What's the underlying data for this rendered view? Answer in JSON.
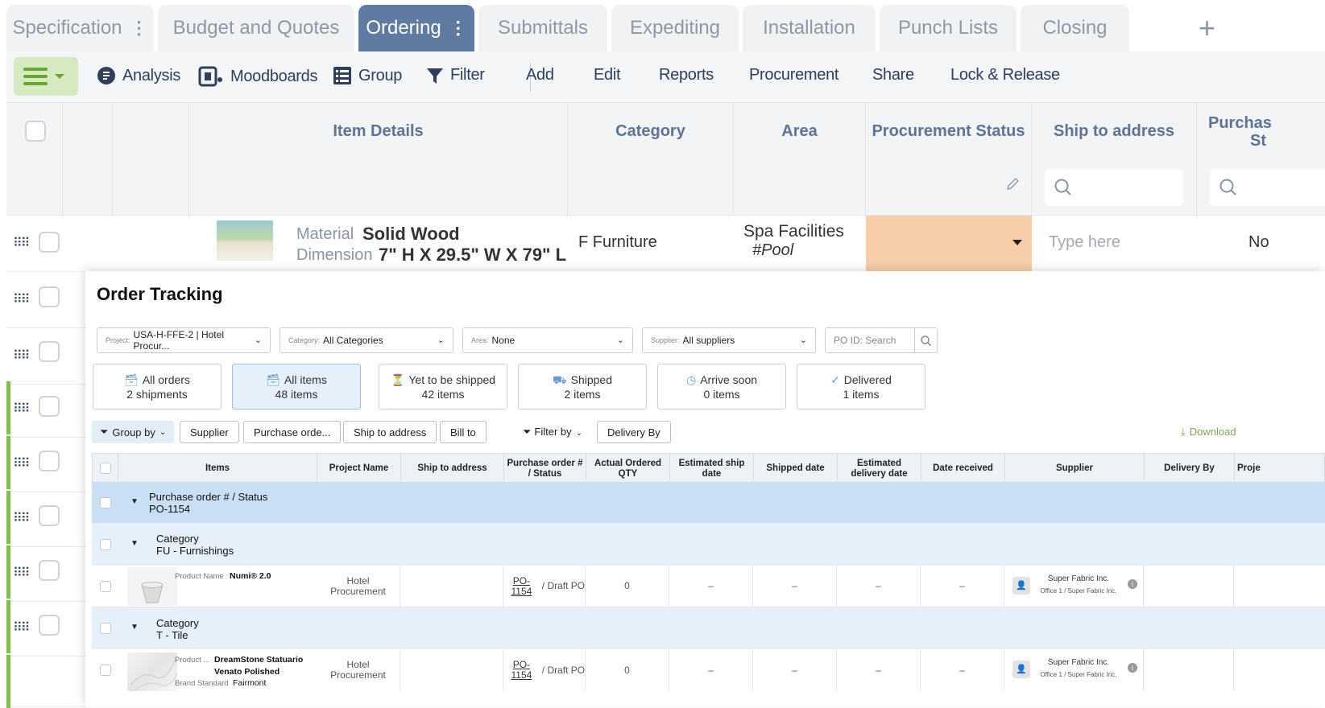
{
  "tabs": [
    {
      "label": "Specification",
      "kebab": "⋮"
    },
    {
      "label": "Budget and Quotes"
    },
    {
      "label": "Ordering",
      "kebab": "⋮"
    },
    {
      "label": "Submittals"
    },
    {
      "label": "Expediting"
    },
    {
      "label": "Installation"
    },
    {
      "label": "Punch Lists"
    },
    {
      "label": "Closing"
    }
  ],
  "add_tab": "+",
  "toolbar": {
    "analysis": "Analysis",
    "moodboards": "Moodboards",
    "group": "Group",
    "filter": "Filter",
    "add": "Add",
    "edit": "Edit",
    "reports": "Reports",
    "procurement": "Procurement",
    "share": "Share",
    "lock_release": "Lock & Release"
  },
  "table": {
    "headers": {
      "item_details": "Item Details",
      "category": "Category",
      "area": "Area",
      "procurement_status": "Procurement Status",
      "ship_to_address": "Ship to address",
      "purchase_status_line1": "Purchas",
      "purchase_status_line2": "St"
    },
    "row1": {
      "material_label": "Material",
      "material_value": "Solid Wood",
      "dimension_label": "Dimension",
      "dimension_value": "7\" H X 29.5\" W X 79\" L",
      "category": "F Furniture",
      "area": "Spa Facilities",
      "area_tag": "#Pool",
      "ship_placeholder": "Type here",
      "purchase_status": "No"
    }
  },
  "modal": {
    "title": "Order Tracking",
    "filters": {
      "project_label": "Project:",
      "project_value": "USA-H-FFE-2 | Hotel Procur...",
      "category_label": "Category:",
      "category_value": "All Categories",
      "area_label": "Area:",
      "area_value": "None",
      "supplier_label": "Supplier:",
      "supplier_value": "All suppliers",
      "po_placeholder": "PO ID: Search"
    },
    "cards": [
      {
        "title": "All orders",
        "sub": "2 shipments"
      },
      {
        "title": "All items",
        "sub": "48 items"
      },
      {
        "title": "Yet to be shipped",
        "sub": "42 items"
      },
      {
        "title": "Shipped",
        "sub": "2 items"
      },
      {
        "title": "Arrive soon",
        "sub": "0 items"
      },
      {
        "title": "Delivered",
        "sub": "1 items"
      }
    ],
    "group_by": "Group by",
    "group_chips": [
      "Supplier",
      "Purchase orde...",
      "Ship to address",
      "Bill to"
    ],
    "filter_by": "Filter by",
    "filter_chips": [
      "Delivery By"
    ],
    "download": "Download",
    "columns": [
      "Items",
      "Project Name",
      "Ship to address",
      "Purchase order # / Status",
      "Actual Ordered QTY",
      "Estimated ship date",
      "Shipped date",
      "Estimated delivery date",
      "Date received",
      "Supplier",
      "Delivery By",
      "Proje"
    ],
    "group_po": {
      "label": "Purchase order # / Status",
      "value": "PO-1154"
    },
    "group_cat1": {
      "label": "Category",
      "value": "FU - Furnishings"
    },
    "item1": {
      "name_label": "Product Name",
      "name": "Numi® 2.0",
      "project": "Hotel Procurement",
      "po": "PO-1154",
      "status": "/ Draft PO",
      "qty": "0",
      "dash": "–",
      "supplier": "Super Fabric Inc.",
      "supplier_sub": "Office 1 / Super Fabric Inc."
    },
    "group_cat2": {
      "label": "Category",
      "value": "T - Tile"
    },
    "item2": {
      "name_label": "Product ...",
      "name_line1": "DreamStone Statuario",
      "name_line2": "Venato Polished",
      "brand_label": "Brand Standard",
      "brand": "Fairmont",
      "project": "Hotel Procurement",
      "po": "PO-1154",
      "status": "/ Draft PO",
      "qty": "0",
      "dash": "–",
      "supplier": "Super Fabric Inc.",
      "supplier_sub": "Office 1 / Super Fabric Inc."
    }
  }
}
